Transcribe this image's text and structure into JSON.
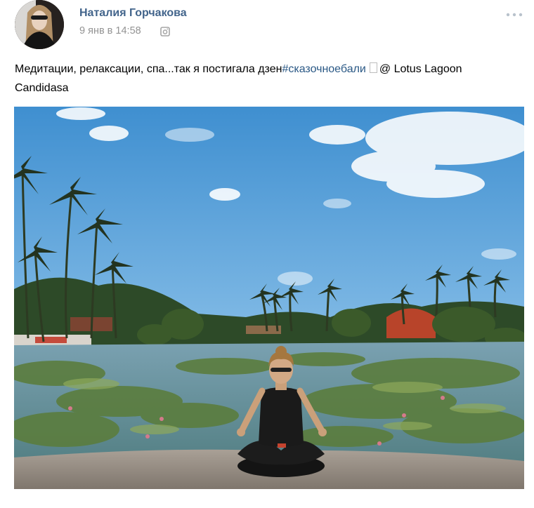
{
  "post": {
    "author": {
      "name": "Наталия Горчакова",
      "avatar_icon": "user-avatar"
    },
    "date": "9 янв в 14:58",
    "source_icon": "instagram-camera-icon",
    "menu_icon": "more-dots-icon",
    "text": {
      "main": "Медитации, релаксации, спа...так я постигала дзен",
      "hashtag": "#сказочноебали",
      "location": "@ Lotus Lagoon Candidasa"
    },
    "photo": {
      "description_icon": "photo-attachment"
    }
  },
  "colors": {
    "author_link": "#42648b",
    "hashtag_link": "#2a5885",
    "meta_text": "#939393"
  }
}
